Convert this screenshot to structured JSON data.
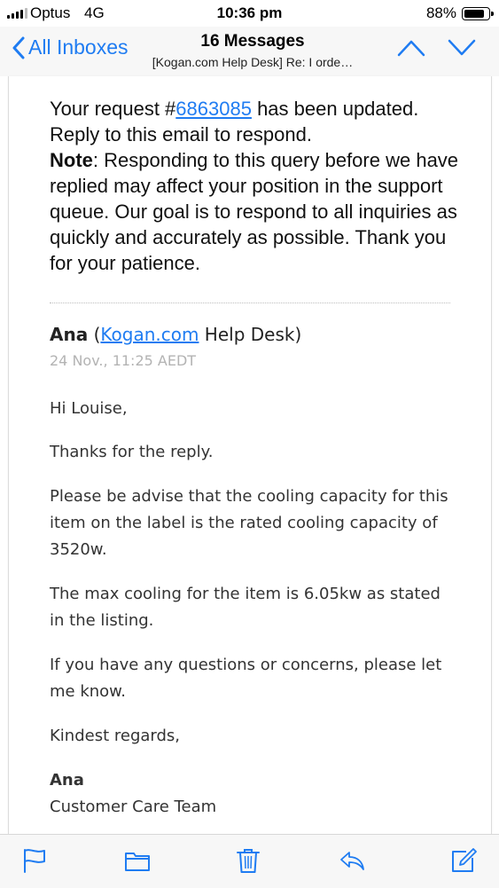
{
  "status_bar": {
    "carrier": "Optus",
    "network": "4G",
    "time": "10:36 pm",
    "battery_percent": "88%",
    "battery_level": 0.88
  },
  "nav": {
    "back_label": "All Inboxes",
    "title": "16 Messages",
    "subtitle": "[Kogan.com Help Desk] Re: I orde…",
    "accent_color": "#1f7cf2"
  },
  "email": {
    "intro_pre": "Your request #",
    "request_number": "6863085",
    "intro_post": " has been updated. Reply to this email to respond.",
    "note_label": "Note",
    "note_text": ": Responding to this query before we have replied may affect your position in the support queue. Our goal is to respond to all inquiries as quickly and accurately as possible. Thank you for your patience.",
    "sender_name": "Ana",
    "sender_open": " (",
    "sender_link": "Kogan.com",
    "sender_rest": " Help Desk)",
    "date": "24 Nov., 11:25 AEDT",
    "greeting": "Hi Louise,",
    "para_thanks": "Thanks for the reply.",
    "para_capacity": "Please be advise that the cooling capacity for this item on the label is the rated cooling capacity of 3520w.",
    "para_max": "The max cooling for the item is 6.05kw as stated in the listing.",
    "para_questions": "If you have any questions or concerns, please let me know.",
    "closing": "Kindest regards,",
    "signature_name": "Ana",
    "signature_team": "Customer Care Team"
  },
  "toolbar": {
    "icons": [
      "flag-icon",
      "folder-icon",
      "trash-icon",
      "reply-icon",
      "compose-icon"
    ]
  }
}
